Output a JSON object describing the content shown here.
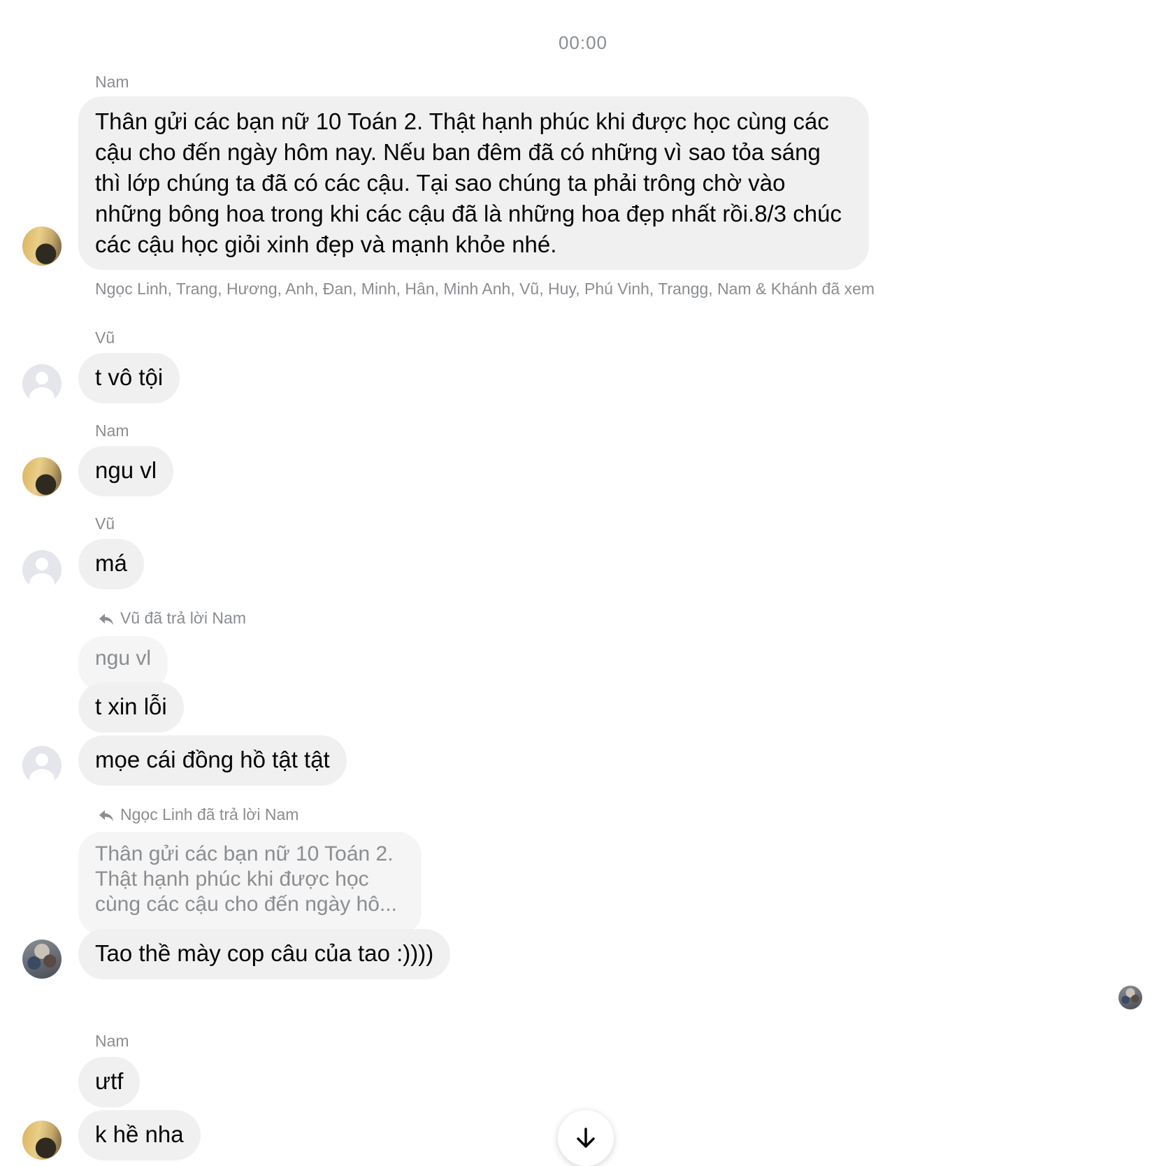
{
  "timestamp": "00:00",
  "messages": {
    "m1": {
      "sender": "Nam",
      "text": "Thân gửi các bạn nữ 10 Toán 2. Thật hạnh phúc khi được học cùng các cậu cho đến ngày hôm nay. Nếu ban đêm đã có những vì sao tỏa sáng thì lớp chúng ta đã có các cậu. Tại sao chúng ta phải trông chờ vào những bông hoa trong khi các cậu đã là những hoa đẹp nhất rồi.8/3 chúc các cậu học giỏi xinh đẹp và mạnh khỏe nhé.",
      "seen_by": "Ngọc Linh, Trang, Hương, Anh, Đan, Minh, Hân, Minh Anh, Vũ, Huy, Phú Vinh, Trangg, Nam & Khánh đã xem"
    },
    "m2": {
      "sender": "Vũ",
      "text": "t vô tội"
    },
    "m3": {
      "sender": "Nam",
      "text": "ngu vl"
    },
    "m4": {
      "sender": "Vũ",
      "text": "má"
    },
    "m5": {
      "reply_note": "Vũ đã trả lời Nam",
      "quoted": "ngu vl",
      "text": "t xin lỗi",
      "text2": "mọe cái đồng hồ tật tật"
    },
    "m6": {
      "reply_note": "Ngọc Linh đã trả lời Nam",
      "quoted": "Thân gửi các bạn nữ 10 Toán 2. Thật hạnh phúc khi được học cùng các cậu cho đến ngày hô...",
      "text": "Tao thề mày cop câu của tao :))))"
    },
    "m7": {
      "sender": "Nam",
      "text": "ưtf",
      "text2": "k hề nha"
    }
  },
  "icons": {
    "reply": "reply-arrow-icon",
    "scroll": "arrow-down-icon"
  }
}
